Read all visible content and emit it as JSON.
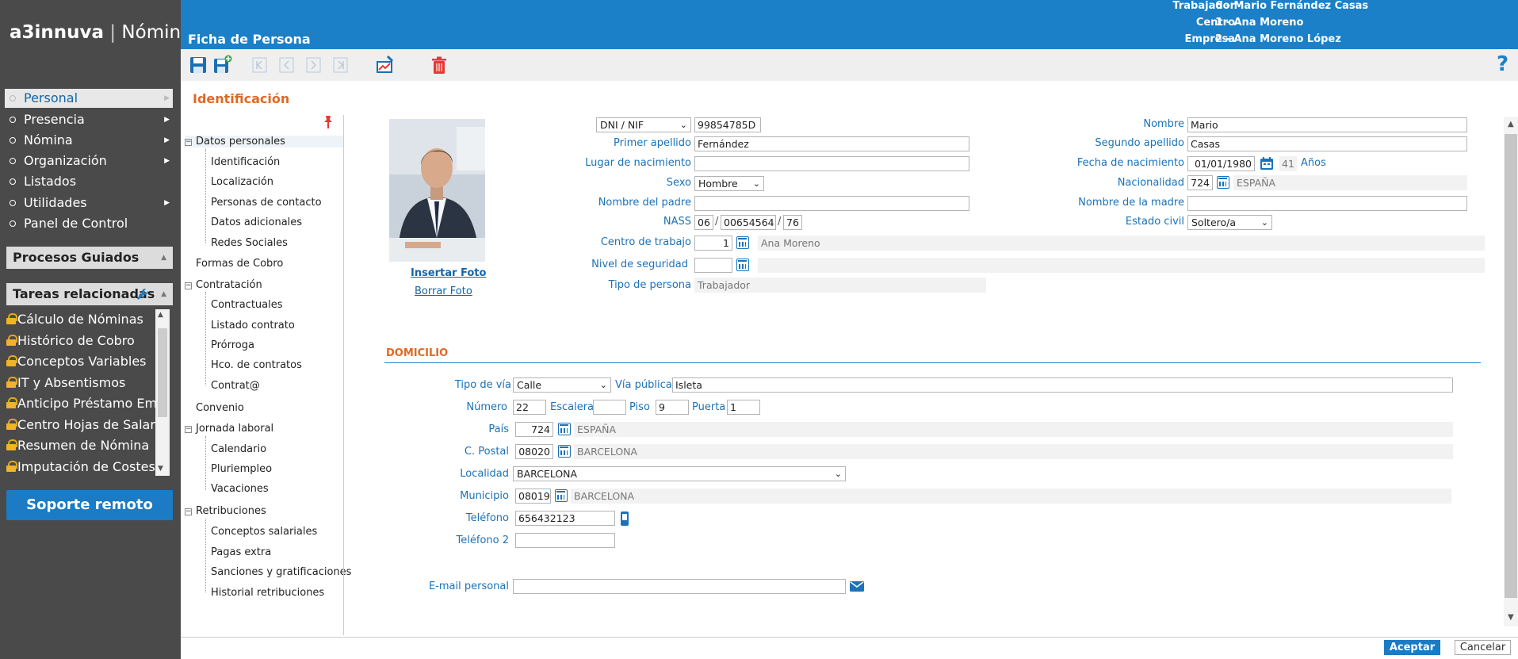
{
  "app": {
    "brand": "a3innuva",
    "separator": "|",
    "product": "Nómina"
  },
  "header": {
    "title": "Ficha de Persona",
    "context": [
      {
        "label": "Trabajador",
        "value": "6 - Mario Fernández Casas"
      },
      {
        "label": "Centro",
        "value": "1 - Ana Moreno"
      },
      {
        "label": "Empresa",
        "value": "2 - Ana Moreno López"
      }
    ],
    "help": "?"
  },
  "sidebar": {
    "nav": [
      {
        "label": "Personal",
        "arrow": "▶"
      },
      {
        "label": "Presencia",
        "arrow": "▶"
      },
      {
        "label": "Nómina",
        "arrow": "▶"
      },
      {
        "label": "Organización",
        "arrow": "▶"
      },
      {
        "label": "Listados",
        "arrow": ""
      },
      {
        "label": "Utilidades",
        "arrow": "▶"
      },
      {
        "label": "Panel de Control",
        "arrow": ""
      }
    ],
    "procesos": "Procesos Guiados",
    "tareas": "Tareas relacionadas",
    "tareas_items": [
      "Cálculo de Nóminas",
      "Histórico de Cobro",
      "Conceptos Variables",
      "IT y Absentismos",
      "Anticipo Préstamo Emb",
      "Centro Hojas de Salario",
      "Resumen de Nómina",
      "Imputación de Costes"
    ],
    "soporte": "Soporte remoto"
  },
  "section_title": "Identificación",
  "tree": {
    "datos_personales": "Datos personales",
    "datos_personales_items": [
      "Identificación",
      "Localización",
      "Personas de contacto",
      "Datos adicionales",
      "Redes Sociales"
    ],
    "formas_cobro": "Formas de Cobro",
    "contratacion": "Contratación",
    "contratacion_items": [
      "Contractuales",
      "Listado contrato",
      "Prórroga",
      "Hco. de contratos",
      "Contrat@"
    ],
    "convenio": "Convenio",
    "jornada": "Jornada laboral",
    "jornada_items": [
      "Calendario",
      "Pluriempleo",
      "Vacaciones"
    ],
    "retribuciones": "Retribuciones",
    "retribuciones_items": [
      "Conceptos salariales",
      "Pagas extra",
      "Sanciones y gratificaciones",
      "Historial retribuciones"
    ]
  },
  "photo": {
    "insert": "Insertar Foto",
    "delete": "Borrar Foto"
  },
  "ident": {
    "doc_type": "DNI / NIF",
    "doc_number": "99854785D",
    "primer_apellido_label": "Primer apellido",
    "primer_apellido": "Fernández",
    "lugar_nac_label": "Lugar de nacimiento",
    "lugar_nac": "",
    "sexo_label": "Sexo",
    "sexo": "Hombre",
    "padre_label": "Nombre del padre",
    "padre": "",
    "nass_label": "NASS",
    "nass_1": "06",
    "nass_2": "00654564",
    "nass_3": "76",
    "slash": "/",
    "centro_label": "Centro de trabajo",
    "centro_code": "1",
    "centro_name": "Ana Moreno",
    "nivel_label": "Nivel de seguridad",
    "nivel_code": "",
    "nivel_name": "",
    "tipo_label": "Tipo de persona",
    "tipo": "Trabajador",
    "nombre_label": "Nombre",
    "nombre": "Mario",
    "segundo_label": "Segundo apellido",
    "segundo": "Casas",
    "fecha_label": "Fecha de nacimiento",
    "fecha": "01/01/1980",
    "edad": "41",
    "edad_unit": "Años",
    "nacionalidad_label": "Nacionalidad",
    "nacionalidad_code": "724",
    "nacionalidad_name": "ESPAÑA",
    "madre_label": "Nombre de la madre",
    "madre": "",
    "estado_label": "Estado civil",
    "estado": "Soltero/a"
  },
  "domicilio": {
    "title": "DOMICILIO",
    "tipo_via_label": "Tipo de vía",
    "tipo_via": "Calle",
    "via_label": "Vía pública",
    "via": "Isleta",
    "numero_label": "Número",
    "numero": "22",
    "escalera_label": "Escalera",
    "escalera": "",
    "piso_label": "Piso",
    "piso": "9",
    "puerta_label": "Puerta",
    "puerta": "1",
    "pais_label": "País",
    "pais_code": "724",
    "pais_name": "ESPAÑA",
    "cp_label": "C. Postal",
    "cp_code": "08020",
    "cp_name": "BARCELONA",
    "localidad_label": "Localidad",
    "localidad": "BARCELONA",
    "municipio_label": "Municipio",
    "municipio_code": "08019",
    "municipio_name": "BARCELONA",
    "telefono_label": "Teléfono",
    "telefono": "656432123",
    "telefono2_label": "Teléfono 2",
    "telefono2": "",
    "email_label": "E-mail personal",
    "email": ""
  },
  "buttons": {
    "accept": "Aceptar",
    "cancel": "Cancelar"
  },
  "colors": {
    "header": "#1b80c8",
    "sidebar": "#4a4a4a",
    "accent": "#e06824",
    "label": "#1b72b8"
  },
  "icons": [
    "save-icon",
    "save-as-icon",
    "first-record-icon",
    "previous-record-icon",
    "next-record-icon",
    "last-record-icon",
    "report-icon",
    "delete-icon",
    "help-icon",
    "pin-icon",
    "calendar-icon",
    "lookup-icon",
    "phone-icon",
    "email-icon",
    "lock-icon"
  ]
}
